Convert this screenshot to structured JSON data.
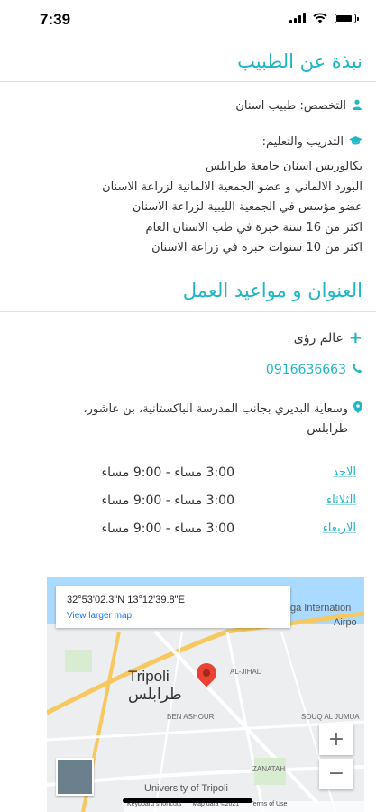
{
  "status": {
    "time": "7:39"
  },
  "about": {
    "title": "نبذة عن الطبيب",
    "specialty": "التخصص: طبيب اسنان",
    "training_heading": "التدريب والتعليم:",
    "training_lines": [
      "بكالوريس اسنان جامعة طرابلس",
      "البورد الالماني و عضو الجمعية الالمانية لزراعة الاسنان",
      "عضو مؤسس في الجمعية الليبية لزراعة الاسنان",
      "اكثر من 16 سنة خبرة في  طب الاسنان العام",
      "اكثر من 10 سنوات خبرة في زراعة الاسنان"
    ]
  },
  "address": {
    "title": "العنوان و مواعيد العمل",
    "clinic_name": "عالم رؤى",
    "phone": "0916636663",
    "street": "وسعاية البديري بجانب المدرسة الباكستانية، بن عاشور،",
    "city": "طرابلس"
  },
  "hours": [
    {
      "day": "الاحد",
      "time": "3:00 مساء - 9:00 مساء"
    },
    {
      "day": "الثلاثاء",
      "time": "3:00 مساء - 9:00 مساء"
    },
    {
      "day": "الاربعاء",
      "time": "3:00 مساء - 9:00 مساء"
    }
  ],
  "map": {
    "coords": "32°53'02.3\"N 13°12'39.8\"E",
    "view_larger": "View larger map",
    "city_en": "Tripoli",
    "city_ar": "طرابلس",
    "labels": [
      "AL-JIHAD",
      "BEN ASHOUR",
      "ZANATAH",
      "SOUQ AL JUMUA",
      "ga Internation",
      "Airpo",
      "University of Tripoli"
    ],
    "zoom_in": "+",
    "zoom_out": "−",
    "footer": [
      "Keyboard shortcuts",
      "Map data ©2021",
      "Terms of Use"
    ],
    "colors": {
      "pin": "#ea4335",
      "water": "#aadaff",
      "link": "#1a73e8"
    }
  },
  "accent_color": "#1fb6c6"
}
